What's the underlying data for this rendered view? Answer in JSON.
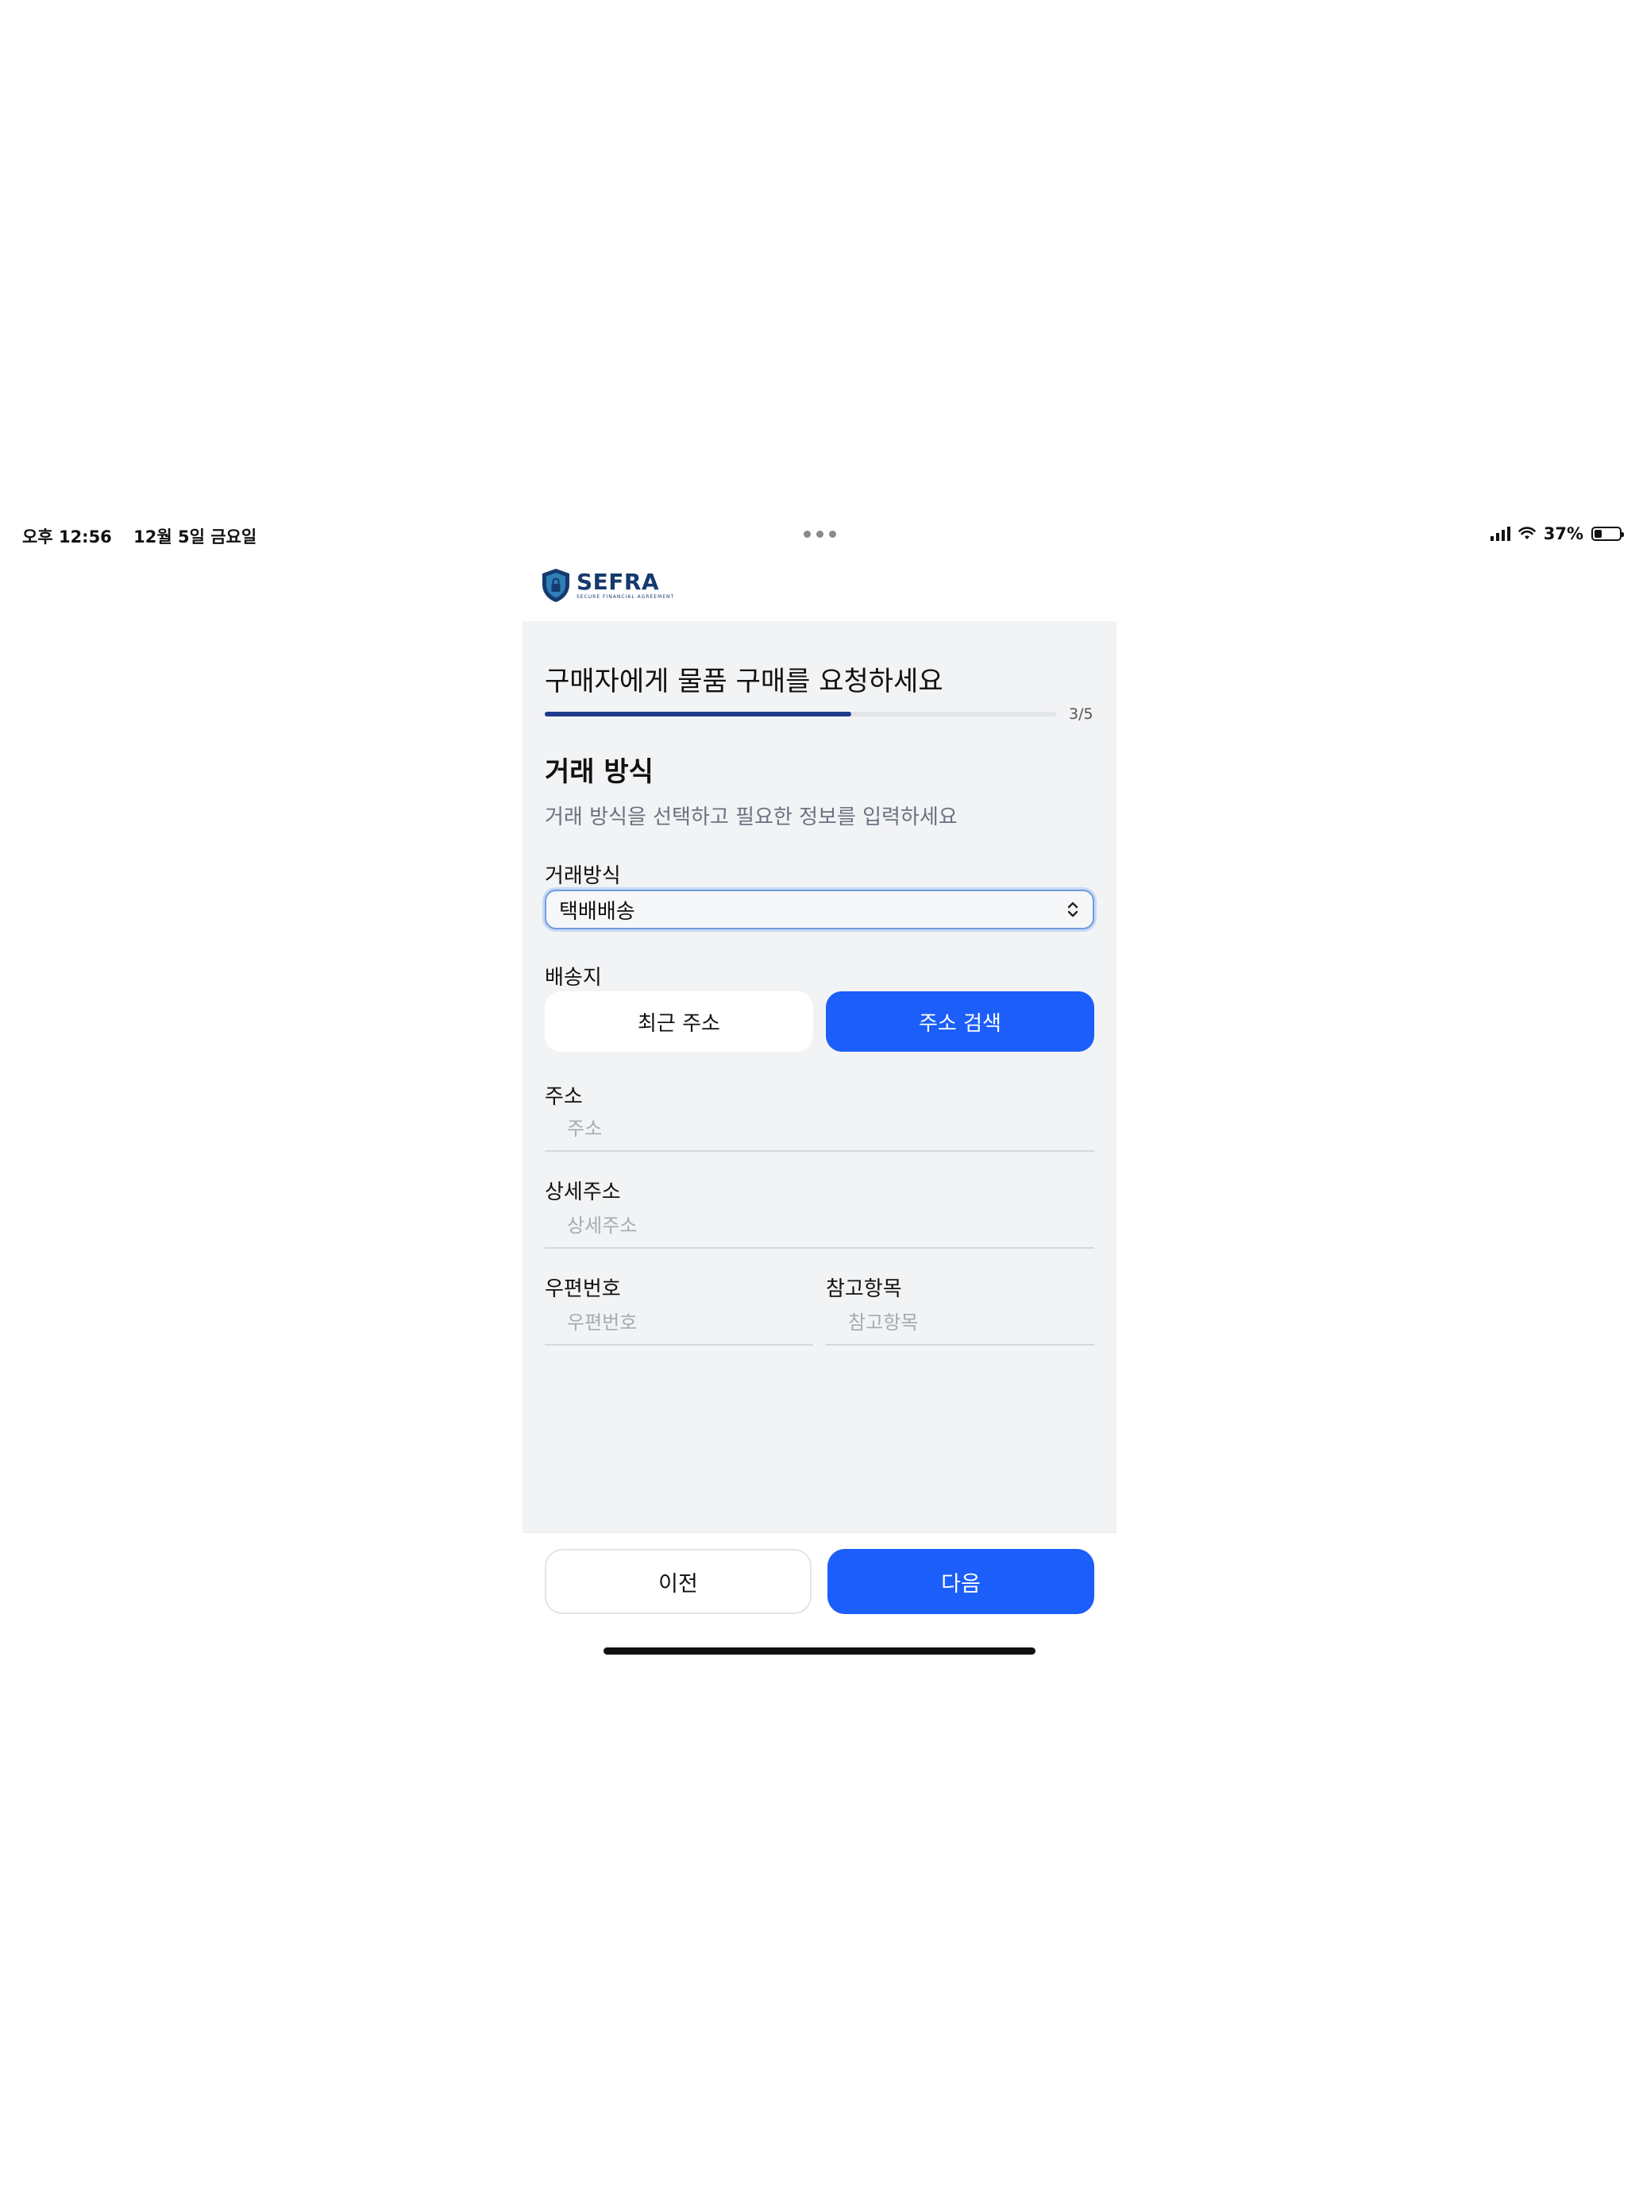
{
  "status_bar": {
    "time": "오후 12:56",
    "date": "12월 5일 금요일",
    "battery_percent": "37%",
    "battery_level": 0.37
  },
  "logo": {
    "name": "SEFRA",
    "subtitle": "SECURE FINANCIAL AGREEMENT"
  },
  "page": {
    "title": "구매자에게 물품 구매를 요청하세요",
    "step_label": "3/5",
    "step_progress": 0.6
  },
  "section": {
    "title": "거래 방식",
    "description": "거래 방식을 선택하고 필요한 정보를 입력하세요"
  },
  "trade_method": {
    "label": "거래방식",
    "selected": "택배배송"
  },
  "shipping": {
    "label": "배송지",
    "recent_button": "최근 주소",
    "search_button": "주소 검색"
  },
  "fields": {
    "address": {
      "label": "주소",
      "placeholder": "주소"
    },
    "detail_address": {
      "label": "상세주소",
      "placeholder": "상세주소"
    },
    "postal_code": {
      "label": "우편번호",
      "placeholder": "우편번호"
    },
    "reference": {
      "label": "참고항목",
      "placeholder": "참고항목"
    }
  },
  "footer": {
    "prev": "이전",
    "next": "다음"
  },
  "colors": {
    "primary": "#1b5efa",
    "progress": "#1e3a8a",
    "panel_bg": "#f2f3f5",
    "logo": "#163a6e"
  }
}
